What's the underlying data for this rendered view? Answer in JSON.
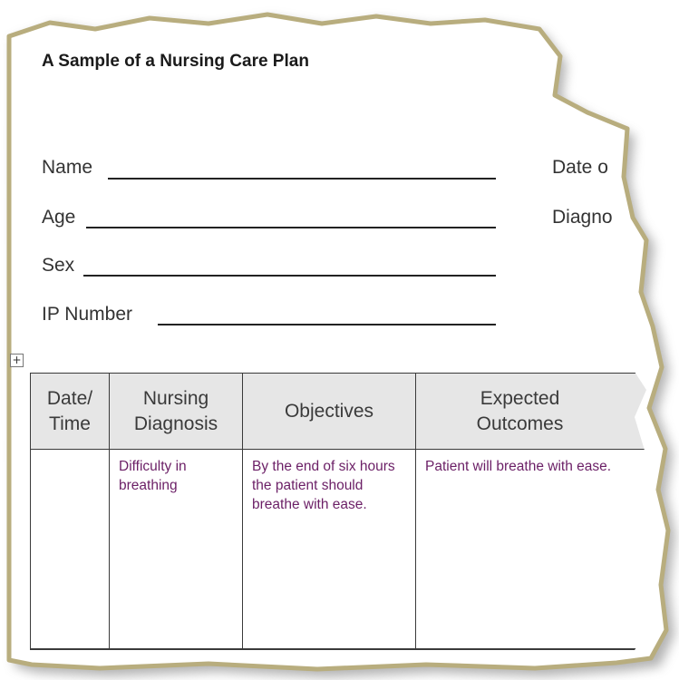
{
  "document": {
    "title": "A Sample of a Nursing Care Plan",
    "fields": {
      "name": "Name",
      "age": "Age",
      "sex": "Sex",
      "ip_number": "IP Number",
      "date_partial": "Date o",
      "diagnosis_partial": "Diagno"
    },
    "table_move_handle_glyph": "+",
    "table": {
      "headers": {
        "date_time": "Date/ Time",
        "nursing_diagnosis": "Nursing Diagnosis",
        "objectives": "Objectives",
        "expected_outcomes": "Expected Outcomes"
      },
      "row": {
        "date_time": "",
        "nursing_diagnosis": "Difficulty in breathing",
        "objectives": "By the end of six hours the patient should breathe with ease.",
        "expected_outcomes": "Patient will breathe with ease."
      }
    }
  },
  "colors": {
    "torn_edge": "#b8ad7e",
    "torn_edge_shadow": "#7a7358",
    "header_bg": "#e6e6e6",
    "body_text": "#6b1f66"
  }
}
